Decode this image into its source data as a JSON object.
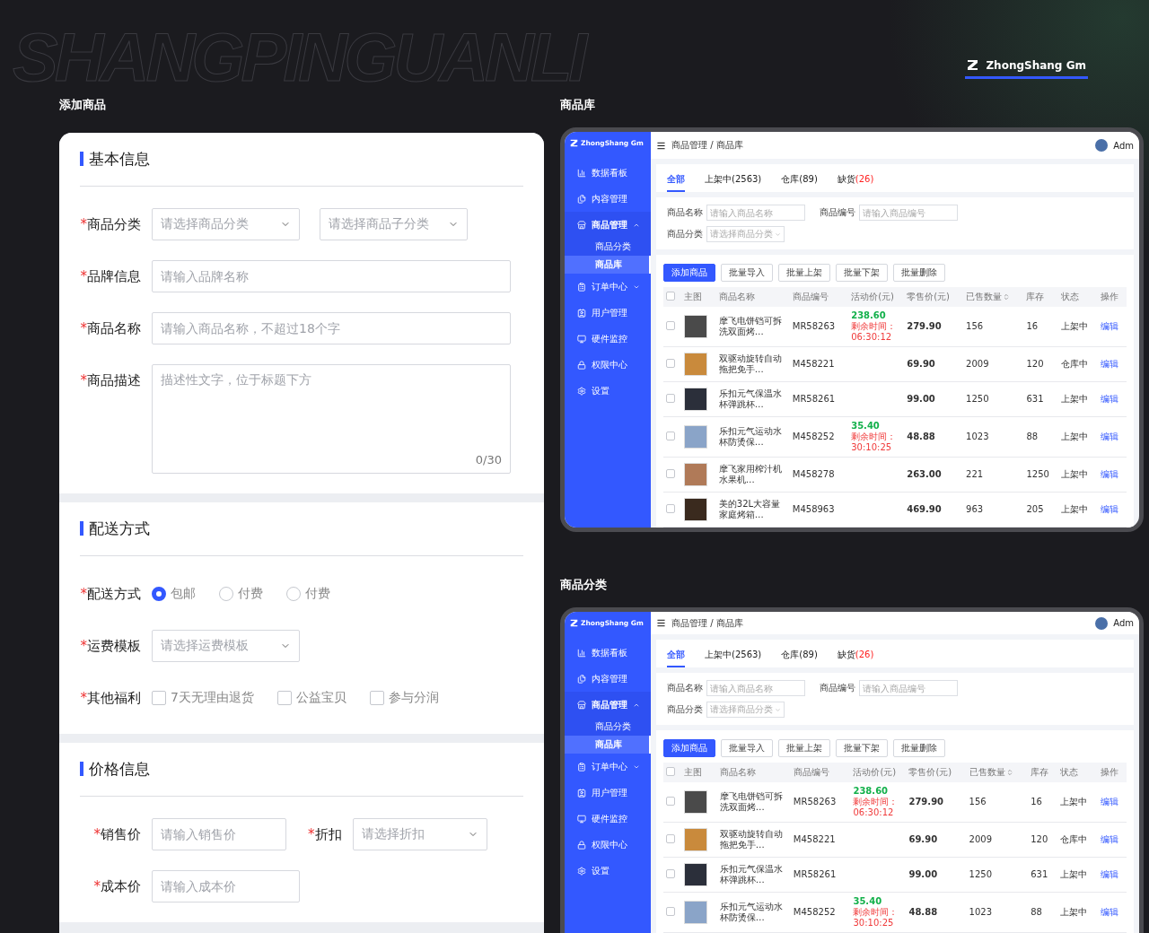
{
  "background_title": "SHANGPINGUANLI",
  "brand": {
    "name": "ZhongShang Gm"
  },
  "form": {
    "title": "添加商品",
    "sections": [
      {
        "title": "基本信息",
        "rows": [
          {
            "fields": [
              {
                "mark": "*",
                "label": "商品分类",
                "controls": [
                  {
                    "kind": "select",
                    "placeholder": "请选择商品分类"
                  },
                  {
                    "kind": "select",
                    "placeholder": "请选择商品子分类"
                  }
                ]
              }
            ]
          },
          {
            "fields": [
              {
                "mark": "*",
                "label": "品牌信息",
                "controls": [
                  {
                    "kind": "input",
                    "placeholder": "请输入品牌名称"
                  }
                ]
              }
            ]
          },
          {
            "fields": [
              {
                "mark": "*",
                "label": "商品名称",
                "controls": [
                  {
                    "kind": "input",
                    "placeholder": "请输入商品名称，不超过18个字"
                  }
                ]
              }
            ]
          },
          {
            "fields": [
              {
                "mark": "*",
                "label": "商品描述",
                "controls": [
                  {
                    "kind": "textarea",
                    "placeholder": "描述性文字，位于标题下方",
                    "counter": "0/30"
                  }
                ]
              }
            ]
          }
        ]
      },
      {
        "title": "配送方式",
        "rows": [
          {
            "fields": [
              {
                "mark": "*",
                "label": "配送方式",
                "controls": [
                  {
                    "kind": "radio",
                    "label": "包邮",
                    "selected": true
                  },
                  {
                    "kind": "radio",
                    "label": "付费",
                    "selected": false
                  },
                  {
                    "kind": "radio",
                    "label": "付费",
                    "selected": false
                  }
                ]
              }
            ]
          },
          {
            "fields": [
              {
                "mark": "*",
                "label": "运费模板",
                "controls": [
                  {
                    "kind": "select",
                    "placeholder": "请选择运费模板"
                  }
                ]
              }
            ]
          },
          {
            "fields": [
              {
                "mark": "*",
                "label": "其他福利",
                "controls": [
                  {
                    "kind": "checkbox",
                    "label": "7天无理由退货",
                    "checked": false
                  },
                  {
                    "kind": "checkbox",
                    "label": "公益宝贝",
                    "checked": false
                  },
                  {
                    "kind": "checkbox",
                    "label": "参与分润",
                    "checked": false
                  }
                ]
              }
            ]
          }
        ]
      },
      {
        "title": "价格信息",
        "rows": [
          {
            "fields": [
              {
                "mark": "*",
                "label": "销售价",
                "controls": [
                  {
                    "kind": "short_input",
                    "placeholder": "请输入销售价"
                  }
                ]
              },
              {
                "mark": "*",
                "label": "折扣",
                "controls": [
                  {
                    "kind": "select",
                    "placeholder": "请选择折扣"
                  }
                ]
              }
            ]
          },
          {
            "fields": [
              {
                "mark": "*",
                "label": "成本价",
                "controls": [
                  {
                    "kind": "short_input",
                    "placeholder": "请输入成本价"
                  }
                ]
              }
            ]
          }
        ]
      }
    ]
  },
  "screens": [
    {
      "title": "商品库",
      "app": {
        "logo": "ZhongShang Gm",
        "breadcrumb": "商品管理 / 商品库",
        "user": "Adm",
        "nav": [
          {
            "label": "数据看板",
            "selected": false
          },
          {
            "label": "内容管理",
            "selected": false
          },
          {
            "label": "商品管理",
            "selected": true,
            "expanded": true,
            "children": [
              {
                "label": "商品分类",
                "selected": false
              },
              {
                "label": "商品库",
                "selected": true
              }
            ]
          },
          {
            "label": "订单中心",
            "selected": false,
            "expanded": false
          },
          {
            "label": "用户管理",
            "selected": false
          },
          {
            "label": "硬件监控",
            "selected": false
          },
          {
            "label": "权限中心",
            "selected": false
          },
          {
            "label": "设置",
            "selected": false
          }
        ],
        "tabs": [
          {
            "label": "全部",
            "selected": true
          },
          {
            "label": "上架中",
            "count": "(2563)",
            "selected": false,
            "alert": false
          },
          {
            "label": "仓库",
            "count": "(89)",
            "selected": false,
            "alert": false
          },
          {
            "label": "缺货",
            "count": "(26)",
            "selected": false,
            "alert": true
          }
        ],
        "filters": [
          {
            "label": "商品名称",
            "kind": "input",
            "placeholder": "请输入商品名称"
          },
          {
            "label": "商品编号",
            "kind": "input",
            "placeholder": "请输入商品编号"
          },
          {
            "label": "商品分类",
            "kind": "select",
            "placeholder": "请选择商品分类"
          }
        ],
        "actions": [
          {
            "label": "添加商品",
            "kind": "primary"
          },
          {
            "label": "批量导入",
            "kind": "default"
          },
          {
            "label": "批量上架",
            "kind": "default"
          },
          {
            "label": "批量下架",
            "kind": "default"
          },
          {
            "label": "批量删除",
            "kind": "default"
          }
        ],
        "all_checked": false,
        "columns": [
          {
            "label": "主图",
            "sortable": false
          },
          {
            "label": "商品名称",
            "sortable": false
          },
          {
            "label": "商品编号",
            "sortable": false
          },
          {
            "label": "活动价(元)",
            "sortable": false
          },
          {
            "label": "零售价(元)",
            "sortable": false
          },
          {
            "label": "已售数量",
            "sortable": true
          },
          {
            "label": "库存",
            "sortable": false
          },
          {
            "label": "状态",
            "sortable": false
          },
          {
            "label": "操作",
            "sortable": false
          }
        ],
        "rows": [
          {
            "checked": false,
            "name": "摩飞电饼铛可拆洗双面烤…",
            "code": "MR58263",
            "promo_price": "238.60",
            "countdown": "剩余时间：06:30:12",
            "price": "279.90",
            "sold": "156",
            "stock": "16",
            "status": "上架中",
            "action": "编辑"
          },
          {
            "checked": false,
            "name": "双驱动旋转自动拖把免手…",
            "code": "M458221",
            "price": "69.90",
            "sold": "2009",
            "stock": "120",
            "status": "仓库中",
            "action": "编辑"
          },
          {
            "checked": false,
            "name": "乐扣元气保温水杯弹跳杯…",
            "code": "MR58261",
            "price": "99.00",
            "sold": "1250",
            "stock": "631",
            "status": "上架中",
            "action": "编辑"
          },
          {
            "checked": false,
            "name": "乐扣元气运动水杯防烫保…",
            "code": "M458252",
            "promo_price": "35.40",
            "countdown": "剩余时间：30:10:25",
            "price": "48.88",
            "sold": "1023",
            "stock": "88",
            "status": "上架中",
            "action": "编辑"
          },
          {
            "checked": false,
            "name": "摩飞家用榨汁机水果机…",
            "code": "M458278",
            "price": "263.00",
            "sold": "221",
            "stock": "1250",
            "status": "上架中",
            "action": "编辑"
          },
          {
            "checked": false,
            "name": "美的32L大容量家庭烤箱…",
            "code": "M458963",
            "price": "469.90",
            "sold": "963",
            "stock": "205",
            "status": "上架中",
            "action": "编辑"
          }
        ]
      }
    },
    {
      "title": "商品分类",
      "app": {
        "logo": "ZhongShang Gm",
        "breadcrumb": "商品管理 / 商品库",
        "user": "Adm",
        "nav": [
          {
            "label": "数据看板",
            "selected": false
          },
          {
            "label": "内容管理",
            "selected": false
          },
          {
            "label": "商品管理",
            "selected": true,
            "expanded": true,
            "children": [
              {
                "label": "商品分类",
                "selected": false
              },
              {
                "label": "商品库",
                "selected": true
              }
            ]
          },
          {
            "label": "订单中心",
            "selected": false,
            "expanded": false
          },
          {
            "label": "用户管理",
            "selected": false
          },
          {
            "label": "硬件监控",
            "selected": false
          },
          {
            "label": "权限中心",
            "selected": false
          },
          {
            "label": "设置",
            "selected": false
          }
        ],
        "tabs": [
          {
            "label": "全部",
            "selected": true
          },
          {
            "label": "上架中",
            "count": "(2563)",
            "selected": false,
            "alert": false
          },
          {
            "label": "仓库",
            "count": "(89)",
            "selected": false,
            "alert": false
          },
          {
            "label": "缺货",
            "count": "(26)",
            "selected": false,
            "alert": true
          }
        ],
        "filters": [
          {
            "label": "商品名称",
            "kind": "input",
            "placeholder": "请输入商品名称"
          },
          {
            "label": "商品编号",
            "kind": "input",
            "placeholder": "请输入商品编号"
          },
          {
            "label": "商品分类",
            "kind": "select",
            "placeholder": "请选择商品分类"
          }
        ],
        "actions": [
          {
            "label": "添加商品",
            "kind": "primary"
          },
          {
            "label": "批量导入",
            "kind": "default"
          },
          {
            "label": "批量上架",
            "kind": "default"
          },
          {
            "label": "批量下架",
            "kind": "default"
          },
          {
            "label": "批量删除",
            "kind": "default"
          }
        ],
        "all_checked": false,
        "columns": [
          {
            "label": "主图",
            "sortable": false
          },
          {
            "label": "商品名称",
            "sortable": false
          },
          {
            "label": "商品编号",
            "sortable": false
          },
          {
            "label": "活动价(元)",
            "sortable": false
          },
          {
            "label": "零售价(元)",
            "sortable": false
          },
          {
            "label": "已售数量",
            "sortable": true
          },
          {
            "label": "库存",
            "sortable": false
          },
          {
            "label": "状态",
            "sortable": false
          },
          {
            "label": "操作",
            "sortable": false
          }
        ],
        "rows": [
          {
            "checked": false,
            "name": "摩飞电饼铛可拆洗双面烤…",
            "code": "MR58263",
            "promo_price": "238.60",
            "countdown": "剩余时间：06:30:12",
            "price": "279.90",
            "sold": "156",
            "stock": "16",
            "status": "上架中",
            "action": "编辑"
          },
          {
            "checked": false,
            "name": "双驱动旋转自动拖把免手…",
            "code": "M458221",
            "price": "69.90",
            "sold": "2009",
            "stock": "120",
            "status": "仓库中",
            "action": "编辑"
          },
          {
            "checked": false,
            "name": "乐扣元气保温水杯弹跳杯…",
            "code": "MR58261",
            "price": "99.00",
            "sold": "1250",
            "stock": "631",
            "status": "上架中",
            "action": "编辑"
          },
          {
            "checked": false,
            "name": "乐扣元气运动水杯防烫保…",
            "code": "M458252",
            "promo_price": "35.40",
            "countdown": "剩余时间：30:10:25",
            "price": "48.88",
            "sold": "1023",
            "stock": "88",
            "status": "上架中",
            "action": "编辑"
          }
        ]
      }
    }
  ]
}
